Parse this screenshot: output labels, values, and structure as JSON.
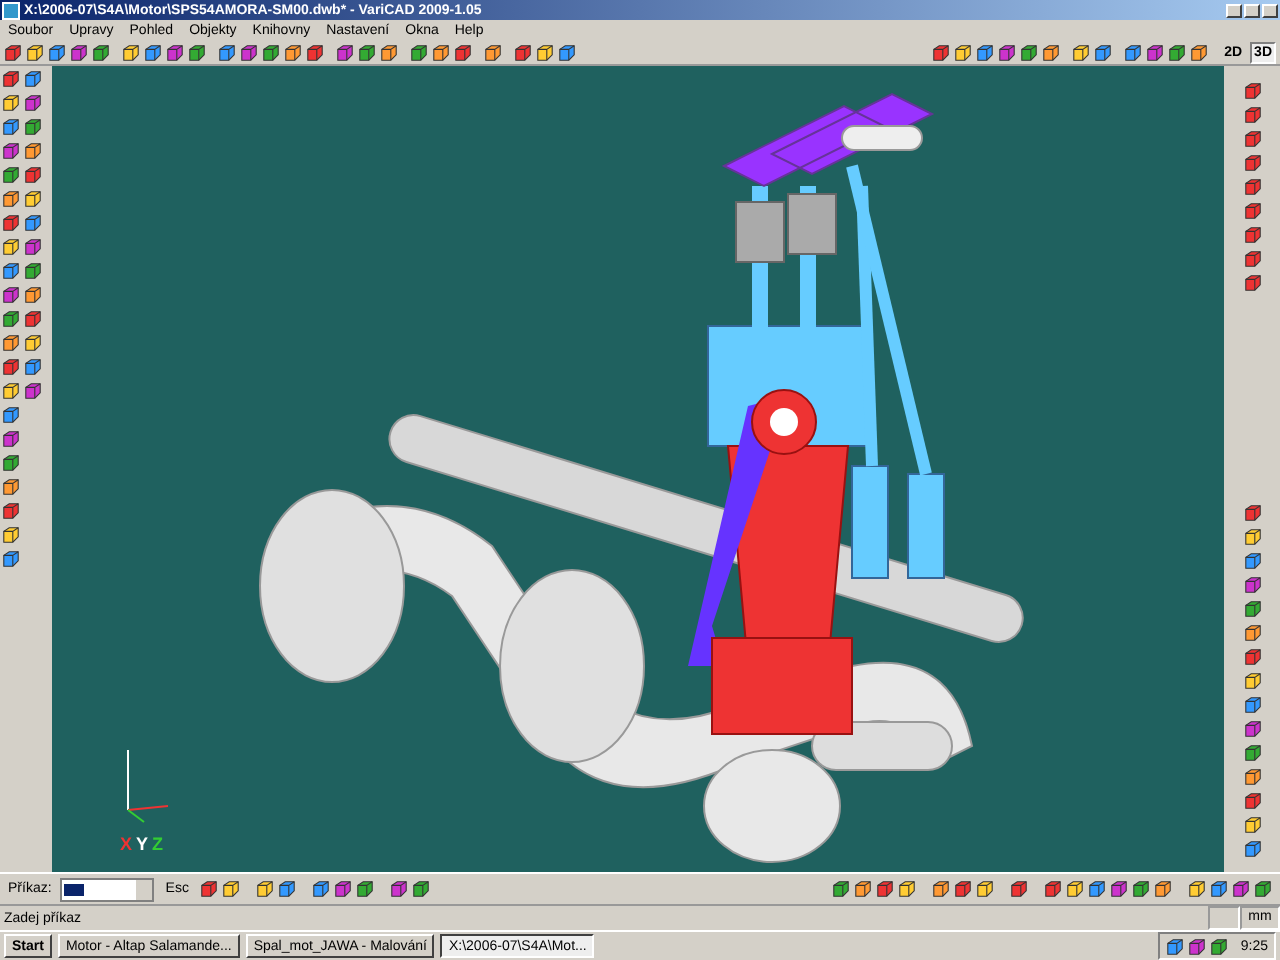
{
  "window": {
    "title": "X:\\2006-07\\S4A\\Motor\\SPS54AMORA-SM00.dwb* - VariCAD 2009-1.05"
  },
  "menu": [
    "Soubor",
    "Upravy",
    "Pohled",
    "Objekty",
    "Knihovny",
    "Nastavení",
    "Okna",
    "Help"
  ],
  "view_buttons": [
    {
      "label": "2D",
      "selected": false
    },
    {
      "label": "3D",
      "selected": true
    }
  ],
  "canvas": {
    "axes": [
      "X",
      "Y",
      "Z"
    ]
  },
  "command_bar": {
    "label": "Příkaz:",
    "button": "Esc"
  },
  "status_bar": {
    "message": "Zadej příkaz",
    "units": "mm"
  },
  "taskbar": {
    "start": "Start",
    "tasks": [
      {
        "label": "Motor - Altap Salamande...",
        "selected": false
      },
      {
        "label": "Spal_mot_JAWA - Malování",
        "selected": false
      },
      {
        "label": "X:\\2006-07\\S4A\\Mot...",
        "selected": true
      }
    ],
    "clock": "9:25"
  }
}
